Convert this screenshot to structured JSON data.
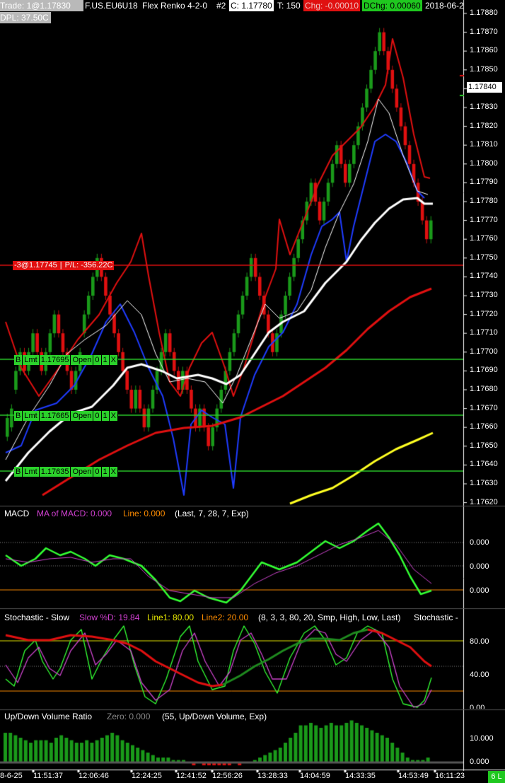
{
  "header": {
    "trade": "Trade: 1@1.17830",
    "symbol": "F.US.EU6U18",
    "chart_type": "Flex Renko 4-2-0",
    "chart_num": "#2",
    "close": "C: 1.17780",
    "ticks": "T: 150",
    "chg": "Chg: -0.00010",
    "dchg": "DChg: 0.00060",
    "date": "2018-06-2",
    "dpl": "DPL: 37.50C"
  },
  "price_axis": {
    "labels": [
      "1.17880",
      "1.17870",
      "1.17860",
      "1.17850",
      "1.17840",
      "1.17830",
      "1.17820",
      "1.17810",
      "1.17800",
      "1.17790",
      "1.17780",
      "1.17770",
      "1.17760",
      "1.17750",
      "1.17740",
      "1.17730",
      "1.17720",
      "1.17710",
      "1.17700",
      "1.17690",
      "1.17680",
      "1.17670",
      "1.17660",
      "1.17650",
      "1.17640",
      "1.17630",
      "1.17620"
    ],
    "current_price": "1.17840"
  },
  "position": {
    "label": "-3@1.17745",
    "pl": "P/L: -356.22C"
  },
  "orders": [
    {
      "side": "B",
      "type": "Lmt",
      "price": "1.17695",
      "status": "Open",
      "filled": "0",
      "qty": "1",
      "cancel": "X"
    },
    {
      "side": "B",
      "type": "Lmt",
      "price": "1.17665",
      "status": "Open",
      "filled": "0",
      "qty": "1",
      "cancel": "X"
    },
    {
      "side": "B",
      "type": "Lmt",
      "price": "1.17635",
      "status": "Open",
      "filled": "0",
      "qty": "1",
      "cancel": "X"
    }
  ],
  "macd": {
    "title": "MACD",
    "ma_label": "MA of MACD: 0.000",
    "line_label": "Line: 0.000",
    "params": "(Last, 7, 28, 7, Exp)",
    "axis": [
      "0.000",
      "0.000",
      "0.000"
    ]
  },
  "stochastic": {
    "title": "Stochastic - Slow",
    "d_label": "Slow %D: 19.84",
    "line1": "Line1: 80.00",
    "line2": "Line2: 20.00",
    "params": "(8, 3, 3, 80, 20, Smp, High, Low, Last)",
    "tail": "Stochastic -",
    "axis": [
      "80.00",
      "40.00",
      "0.00"
    ]
  },
  "volume": {
    "title": "Up/Down Volume Ratio",
    "zero": "Zero: 0.000",
    "params": "(55, Up/Down Volume, Exp)",
    "axis": [
      "10.000",
      "0.000"
    ]
  },
  "time_axis": {
    "labels": [
      "8-6-25",
      "11:51:37",
      "12:06:46",
      "12:24:25",
      "12:41:52",
      "12:56:26",
      "13:28:33",
      "14:04:59",
      "14:33:35",
      "14:53:49",
      "16:11:23"
    ],
    "corner": "6 L"
  },
  "colors": {
    "up": "#1a9a1a",
    "down": "#e01010",
    "macd": "#33ff33",
    "macd_ma": "#cc44cc",
    "order_green": "#2bd22b",
    "yellow_ma": "#ffff22"
  }
}
